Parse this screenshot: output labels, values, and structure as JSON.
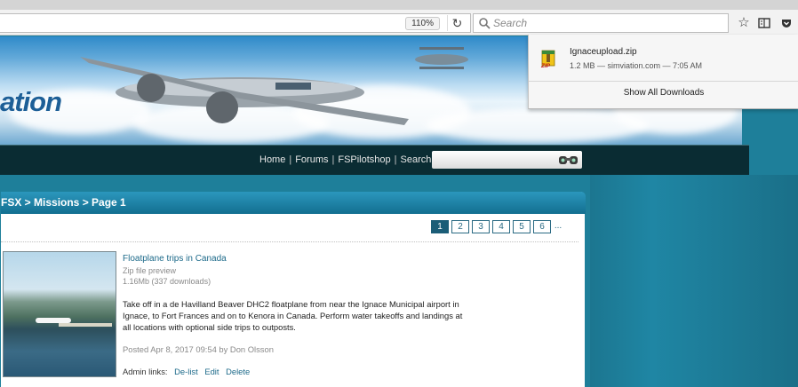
{
  "browser": {
    "zoom_level": "110%",
    "search_placeholder": "Search"
  },
  "banner": {
    "brand_text": "ation"
  },
  "nav": {
    "links": [
      "Home",
      "Forums",
      "FSPilotshop",
      "Search"
    ],
    "separator": "|"
  },
  "content": {
    "breadcrumb": "FSX > Missions > Page 1",
    "pagination": [
      "1",
      "2",
      "3",
      "4",
      "5",
      "6"
    ],
    "pagination_more": "...",
    "active_page": "1",
    "item": {
      "title": "Floatplane trips in Canada",
      "preview_label": "Zip file preview",
      "size_downloads": "1.16Mb (337 downloads)",
      "description": "Take off in a de Havilland Beaver DHC2 floatplane from near the Ignace Municipal airport in Ignace, to Fort Frances and on to Kenora in Canada. Perform water takeoffs and landings at all locations with optional side trips to outposts.",
      "posted": "Posted Apr 8, 2017 09:54 by Don Olsson",
      "admin_label": "Admin links:",
      "admin_links": [
        "De-list",
        "Edit",
        "Delete"
      ]
    }
  },
  "downloads": {
    "file_name": "Ignaceupload.zip",
    "file_info": "1.2 MB — simviation.com — 7:05 AM",
    "show_all": "Show All Downloads"
  },
  "colors": {
    "page_teal": "#1e7f9a",
    "nav_dark": "#0a2c33",
    "link_blue": "#1d6a8a"
  }
}
